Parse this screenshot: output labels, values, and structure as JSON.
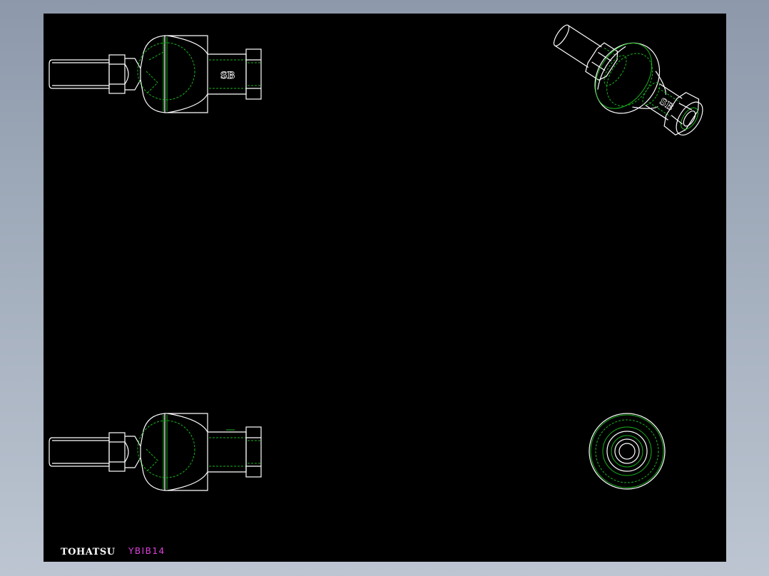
{
  "drawing": {
    "background_color": "#000000",
    "outline_color": "#ffffff",
    "hidden_line_color": "#19b31d",
    "views": [
      {
        "name": "front-view",
        "engraving": "SB"
      },
      {
        "name": "isometric-view",
        "engraving": "SB"
      },
      {
        "name": "section-view",
        "engraving": ""
      },
      {
        "name": "end-view",
        "engraving": ""
      }
    ]
  },
  "title_block": {
    "brand": "TOHATSU",
    "brand_color": "#ffffff",
    "part_code": "YBIB14",
    "part_code_color": "#e040e0"
  }
}
